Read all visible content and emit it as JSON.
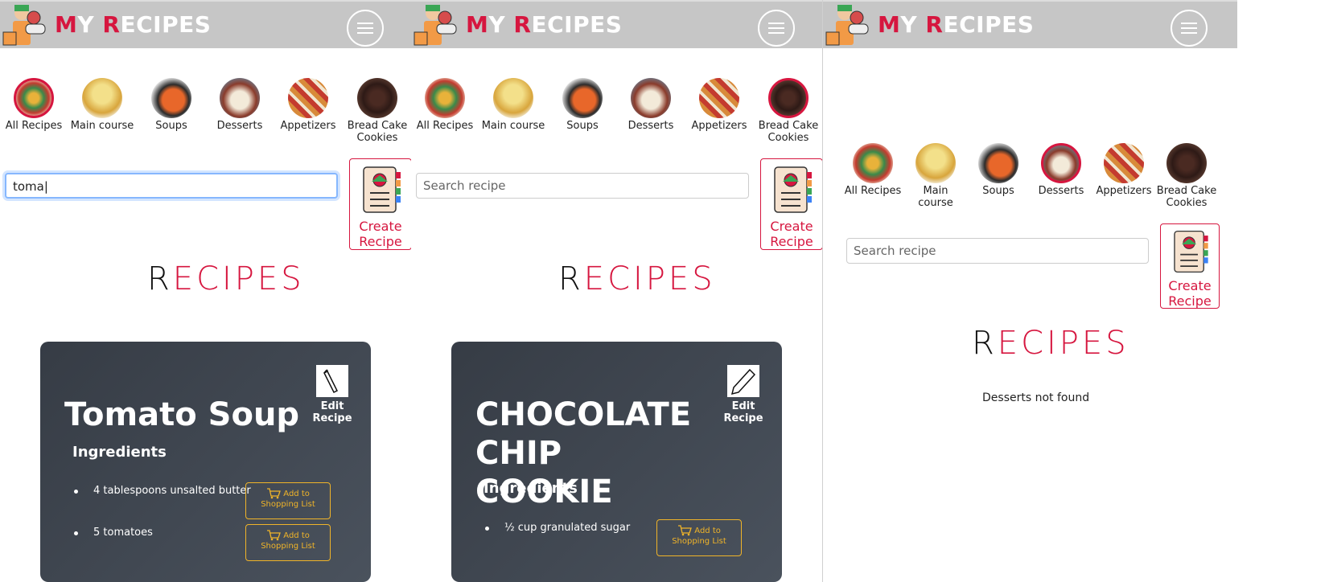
{
  "app": {
    "logo_m": "M",
    "logo_y": "Y ",
    "logo_r": "R",
    "logo_rest": "ECIPES"
  },
  "categories": [
    {
      "label": "All Recipes"
    },
    {
      "label": "Main course"
    },
    {
      "label": "Soups"
    },
    {
      "label": "Desserts"
    },
    {
      "label": "Appetizers"
    },
    {
      "label": "Bread Cake Cookies"
    }
  ],
  "panel3_categories": [
    {
      "label": "All Recipes"
    },
    {
      "label": "Main course"
    },
    {
      "label": "Soups"
    },
    {
      "label": "Desserts"
    },
    {
      "label": "Appetizers"
    },
    {
      "label": "Bread Cake Cookies"
    }
  ],
  "search": {
    "placeholder": "Search recipe",
    "panel1_value": "toma"
  },
  "create": {
    "line1": "Create",
    "line2": "Recipe"
  },
  "section_title": {
    "first": "R",
    "rest": "ECIPES"
  },
  "edit": {
    "line1": "Edit",
    "line2": "Recipe"
  },
  "panel1_card": {
    "title": "Tomato Soup",
    "ingredients_heading": "Ingredients",
    "ingredients": [
      "4 tablespoons unsalted butter",
      "5 tomatoes"
    ]
  },
  "panel2_card": {
    "title_line1": "CHOCOLATE CHIP",
    "title_line2": "COOKIE",
    "ingredients_heading": "Ingredients",
    "ingredients": [
      "½ cup granulated sugar"
    ]
  },
  "shopping": {
    "line1": "Add to",
    "line2": "Shopping List"
  },
  "panel3": {
    "not_found": "Desserts not found"
  },
  "colors": {
    "accent": "#d6163f",
    "header": "#c6c6c6",
    "card": "#3d444e",
    "shop": "#f0b429"
  }
}
